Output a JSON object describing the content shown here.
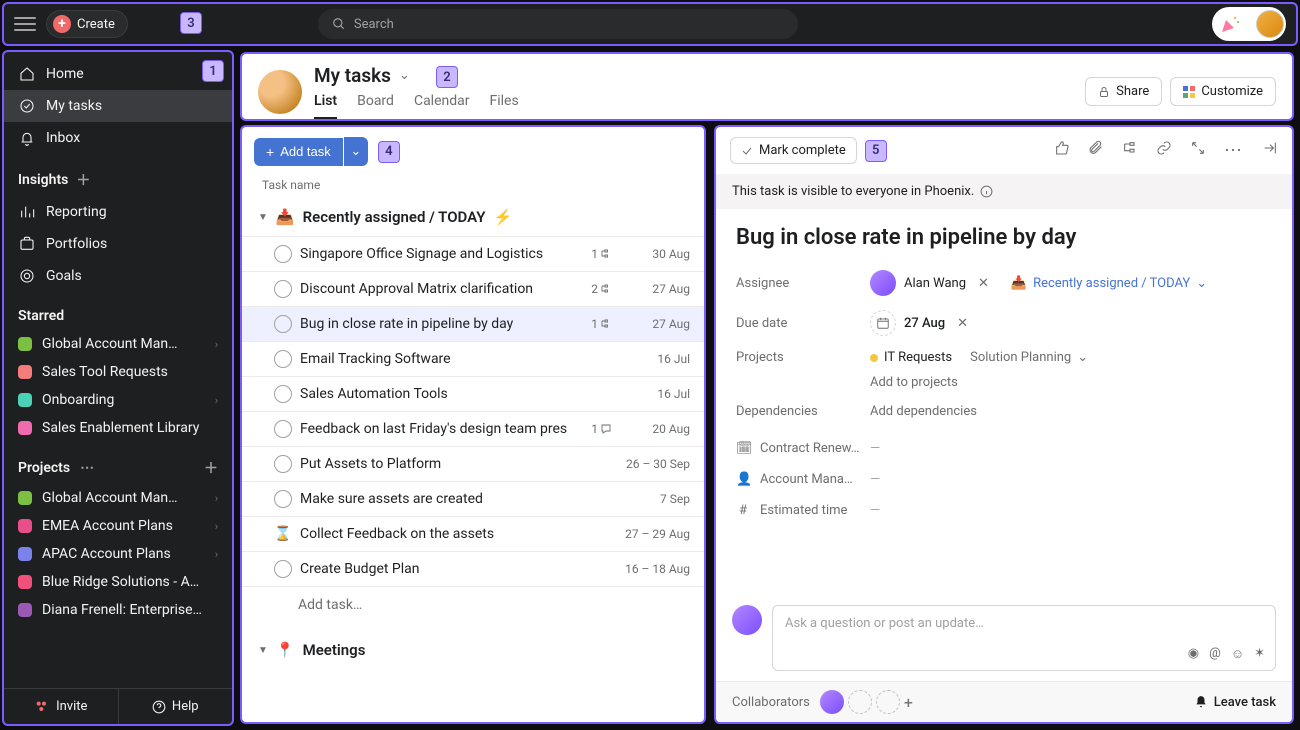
{
  "topbar": {
    "create_label": "Create",
    "search_placeholder": "Search"
  },
  "markers": {
    "m1": "1",
    "m2": "2",
    "m3": "3",
    "m4": "4",
    "m5": "5"
  },
  "sidebar": {
    "nav": {
      "home": "Home",
      "mytasks": "My tasks",
      "inbox": "Inbox"
    },
    "insights": {
      "header": "Insights",
      "reporting": "Reporting",
      "portfolios": "Portfolios",
      "goals": "Goals"
    },
    "starred": {
      "header": "Starred",
      "items": [
        {
          "name": "Global Account Man…",
          "color": "#7bc043",
          "hasSub": true
        },
        {
          "name": "Sales Tool Requests",
          "color": "#f37c7c",
          "hasSub": false
        },
        {
          "name": "Onboarding",
          "color": "#4bd1b3",
          "hasSub": true
        },
        {
          "name": "Sales Enablement Library",
          "color": "#f06ab0",
          "hasSub": false
        }
      ]
    },
    "projects": {
      "header": "Projects",
      "items": [
        {
          "name": "Global Account Man…",
          "color": "#7bc043",
          "hasSub": true
        },
        {
          "name": "EMEA Account Plans",
          "color": "#e84e8a",
          "hasSub": true
        },
        {
          "name": "APAC Account Plans",
          "color": "#7b83eb",
          "hasSub": true
        },
        {
          "name": "Blue Ridge Solutions - A…",
          "color": "#f0517a",
          "hasSub": false
        },
        {
          "name": "Diana Frenell: Enterprise…",
          "color": "#9b59b6",
          "hasSub": false
        }
      ]
    },
    "footer": {
      "invite": "Invite",
      "help": "Help"
    }
  },
  "header": {
    "title": "My tasks",
    "tabs": {
      "list": "List",
      "board": "Board",
      "calendar": "Calendar",
      "files": "Files"
    },
    "share": "Share",
    "customize": "Customize"
  },
  "tasklist": {
    "add_task": "Add task",
    "column_header": "Task name",
    "section_recent": "Recently assigned / TODAY",
    "section_recent_icon": "📥",
    "section_recent_icon2": "⚡",
    "tasks": [
      {
        "name": "Singapore Office Signage and Logistics",
        "subtasks": "1",
        "comments": "",
        "date": "30 Aug",
        "selected": false,
        "icon": "check"
      },
      {
        "name": "Discount Approval Matrix clarification",
        "subtasks": "2",
        "comments": "",
        "date": "27 Aug",
        "selected": false,
        "icon": "check"
      },
      {
        "name": "Bug in close rate in pipeline by day",
        "subtasks": "1",
        "comments": "",
        "date": "27 Aug",
        "selected": true,
        "icon": "check"
      },
      {
        "name": "Email Tracking Software",
        "subtasks": "",
        "comments": "",
        "date": "16 Jul",
        "selected": false,
        "icon": "check"
      },
      {
        "name": "Sales Automation Tools",
        "subtasks": "",
        "comments": "",
        "date": "16 Jul",
        "selected": false,
        "icon": "check"
      },
      {
        "name": "Feedback on last Friday's design team pres",
        "subtasks": "",
        "comments": "1",
        "date": "20 Aug",
        "selected": false,
        "icon": "check"
      },
      {
        "name": "Put Assets to Platform",
        "subtasks": "",
        "comments": "",
        "date": "26 – 30 Sep",
        "selected": false,
        "icon": "check"
      },
      {
        "name": "Make sure assets are created",
        "subtasks": "",
        "comments": "",
        "date": "7 Sep",
        "selected": false,
        "icon": "check"
      },
      {
        "name": "Collect Feedback on the assets",
        "subtasks": "",
        "comments": "",
        "date": "27 – 29 Aug",
        "selected": false,
        "icon": "hourglass"
      },
      {
        "name": "Create Budget Plan",
        "subtasks": "",
        "comments": "",
        "date": "16 – 18 Aug",
        "selected": false,
        "icon": "check"
      }
    ],
    "add_task_placeholder": "Add task…",
    "section_meetings": "Meetings",
    "section_meetings_icon": "📍"
  },
  "detail": {
    "mark_complete": "Mark complete",
    "visibility": "This task is visible to everyone in Phoenix.",
    "title": "Bug in close rate in pipeline by day",
    "fields": {
      "assignee_label": "Assignee",
      "assignee_value": "Alan Wang",
      "section_value": "Recently assigned / TODAY ",
      "duedate_label": "Due date",
      "duedate_value": "27 Aug",
      "projects_label": "Projects",
      "project1": "IT Requests",
      "project1_color": "#f2c744",
      "project2": "Solution Planning",
      "add_to_projects": "Add to projects",
      "deps_label": "Dependencies",
      "deps_value": "Add dependencies"
    },
    "custom_fields": [
      {
        "icon": "🗓",
        "label": "Contract Renew…",
        "value": "—"
      },
      {
        "icon": "👤",
        "label": "Account Manager",
        "value": "—"
      },
      {
        "icon": "#",
        "label": "Estimated time",
        "value": "—"
      }
    ],
    "comment_placeholder": "Ask a question or post an update…",
    "collaborators_label": "Collaborators",
    "leave_task": "Leave task"
  }
}
